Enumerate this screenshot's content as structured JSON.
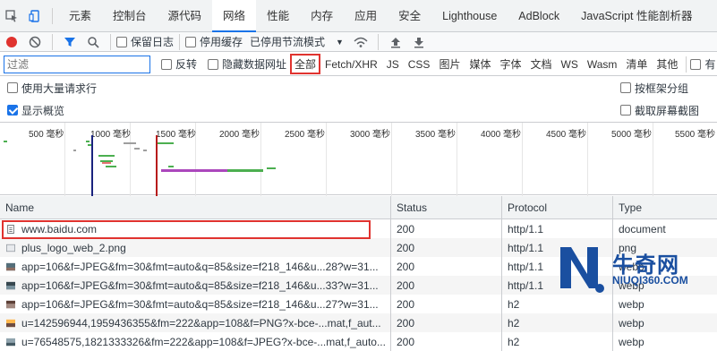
{
  "tabs": [
    "元素",
    "控制台",
    "源代码",
    "网络",
    "性能",
    "内存",
    "应用",
    "安全",
    "Lighthouse",
    "AdBlock",
    "JavaScript 性能剖析器"
  ],
  "toolbar": {
    "preserve_log": "保留日志",
    "disable_cache": "停用缓存",
    "throttle": "已停用节流模式"
  },
  "filter": {
    "placeholder": "过滤",
    "invert": "反转",
    "hide_data_urls": "隐藏数据网址",
    "types": [
      "全部",
      "Fetch/XHR",
      "JS",
      "CSS",
      "图片",
      "媒体",
      "字体",
      "文档",
      "WS",
      "Wasm",
      "清单",
      "其他"
    ],
    "more": "有"
  },
  "options": {
    "large_rows": "使用大量请求行",
    "group_by_frame": "按框架分组",
    "show_overview": "显示概览",
    "capture_screenshots": "截取屏幕截图"
  },
  "overview": {
    "ticks": [
      "500 毫秒",
      "1000 毫秒",
      "1500 毫秒",
      "2000 毫秒",
      "2500 毫秒",
      "3000 毫秒",
      "3500 毫秒",
      "4000 毫秒",
      "4500 毫秒",
      "5000 毫秒",
      "5500 毫秒"
    ]
  },
  "table": {
    "headers": [
      "Name",
      "Status",
      "Protocol",
      "Type"
    ],
    "rows": [
      {
        "name": "www.baidu.com",
        "status": "200",
        "protocol": "http/1.1",
        "type": "document"
      },
      {
        "name": "plus_logo_web_2.png",
        "status": "200",
        "protocol": "http/1.1",
        "type": "png"
      },
      {
        "name": "app=106&f=JPEG&fm=30&fmt=auto&q=85&size=f218_146&u...28?w=31...",
        "status": "200",
        "protocol": "http/1.1",
        "type": "webp"
      },
      {
        "name": "app=106&f=JPEG&fm=30&fmt=auto&q=85&size=f218_146&u...33?w=31...",
        "status": "200",
        "protocol": "http/1.1",
        "type": "webp"
      },
      {
        "name": "app=106&f=JPEG&fm=30&fmt=auto&q=85&size=f218_146&u...27?w=31...",
        "status": "200",
        "protocol": "h2",
        "type": "webp"
      },
      {
        "name": "u=142596944,1959436355&fm=222&app=108&f=PNG?x-bce-...mat,f_aut...",
        "status": "200",
        "protocol": "h2",
        "type": "webp"
      },
      {
        "name": "u=76548575,1821333326&fm=222&app=108&f=JPEG?x-bce-...mat,f_auto...",
        "status": "200",
        "protocol": "h2",
        "type": "webp"
      }
    ]
  },
  "watermark": {
    "brand": "牛奇网",
    "url": "NIUQI360.COM"
  }
}
